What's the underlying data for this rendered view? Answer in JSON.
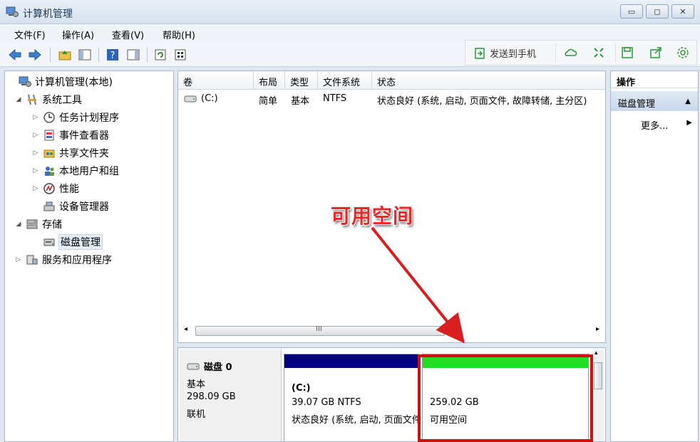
{
  "window": {
    "title": "计算机管理"
  },
  "menu": [
    "文件(F)",
    "操作(A)",
    "查看(V)",
    "帮助(H)"
  ],
  "toolbar_right": {
    "send_label": "发送到手机"
  },
  "tree": [
    {
      "label": "计算机管理(本地)",
      "icon": "computer-management-icon",
      "indent": 0,
      "toggle": ""
    },
    {
      "label": "系统工具",
      "icon": "system-tools-icon",
      "indent": 1,
      "toggle": "◢"
    },
    {
      "label": "任务计划程序",
      "icon": "task-scheduler-icon",
      "indent": 2,
      "toggle": "▷"
    },
    {
      "label": "事件查看器",
      "icon": "event-viewer-icon",
      "indent": 2,
      "toggle": "▷"
    },
    {
      "label": "共享文件夹",
      "icon": "shared-folders-icon",
      "indent": 2,
      "toggle": "▷"
    },
    {
      "label": "本地用户和组",
      "icon": "local-users-icon",
      "indent": 2,
      "toggle": "▷"
    },
    {
      "label": "性能",
      "icon": "performance-icon",
      "indent": 2,
      "toggle": "▷"
    },
    {
      "label": "设备管理器",
      "icon": "device-manager-icon",
      "indent": 2,
      "toggle": ""
    },
    {
      "label": "存储",
      "icon": "storage-icon",
      "indent": 1,
      "toggle": "◢"
    },
    {
      "label": "磁盘管理",
      "icon": "disk-management-icon",
      "indent": 2,
      "toggle": "",
      "selected": true
    },
    {
      "label": "服务和应用程序",
      "icon": "services-apps-icon",
      "indent": 1,
      "toggle": "▷"
    }
  ],
  "volume_table": {
    "headers": [
      "卷",
      "布局",
      "类型",
      "文件系统",
      "状态"
    ],
    "rows": [
      {
        "volume": "(C:)",
        "layout": "简单",
        "type": "基本",
        "fs": "NTFS",
        "status": "状态良好 (系统, 启动, 页面文件, 故障转储, 主分区)"
      }
    ],
    "scroll_label": "III"
  },
  "disk": {
    "name": "磁盘 0",
    "type": "基本",
    "size": "298.09 GB",
    "state": "联机",
    "partitions": [
      {
        "name": "(C:)",
        "detail": "39.07 GB NTFS",
        "status": "状态良好 (系统, 启动, 页面文件, 故障转储, 主分区)",
        "color": "#000080"
      },
      {
        "name": "",
        "detail": "259.02 GB",
        "status": "可用空间",
        "color": "#22dd22"
      }
    ]
  },
  "actions": {
    "header": "操作",
    "section": "磁盘管理",
    "more": "更多..."
  },
  "annotation": {
    "text": "可用空间",
    "color": "#e8272a"
  },
  "colors": {
    "unallocated_green": "#22dd22",
    "primary_blue": "#000080",
    "highlight_red": "#cc1111"
  }
}
